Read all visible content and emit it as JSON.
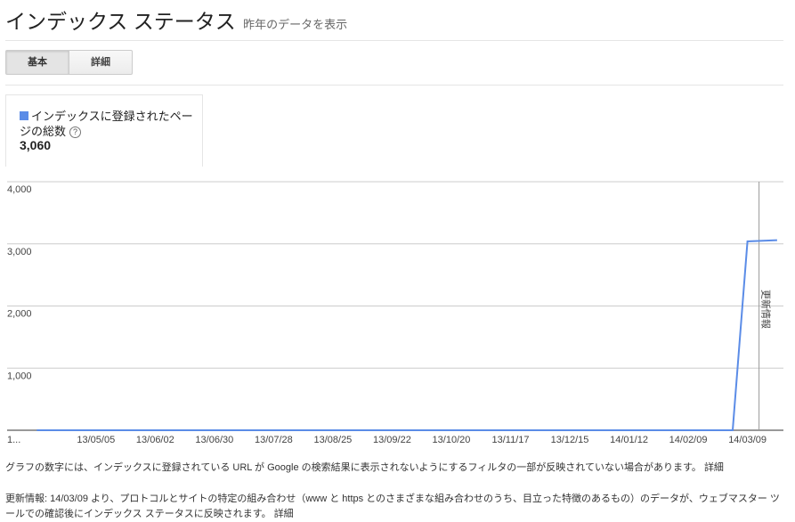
{
  "header": {
    "title": "インデックス ステータス",
    "subtitle": "昨年のデータを表示"
  },
  "tabs": [
    {
      "label": "基本",
      "active": true
    },
    {
      "label": "詳細",
      "active": false
    }
  ],
  "metric": {
    "label": "インデックスに登録されたページの総数",
    "value": "3,060",
    "color": "#5b8ce7",
    "help_icon": "question-circle-icon"
  },
  "chart_data": {
    "type": "line",
    "x": [
      "13/04/07",
      "13/05/05",
      "13/06/02",
      "13/06/30",
      "13/07/28",
      "13/08/25",
      "13/09/22",
      "13/10/20",
      "13/11/17",
      "13/12/15",
      "14/01/12",
      "14/02/09",
      "14/03/02",
      "14/03/09",
      "14/03/23"
    ],
    "series": [
      {
        "name": "インデックスに登録されたページの総数",
        "values": [
          0,
          0,
          0,
          0,
          0,
          0,
          0,
          0,
          0,
          0,
          0,
          0,
          0,
          3040,
          3060
        ]
      }
    ],
    "tick_labels_x": [
      "1...",
      "13/05/05",
      "13/06/02",
      "13/06/30",
      "13/07/28",
      "13/08/25",
      "13/09/22",
      "13/10/20",
      "13/11/17",
      "13/12/15",
      "14/01/12",
      "14/02/09",
      "14/03/09"
    ],
    "tick_labels_y": [
      "1,000",
      "2,000",
      "3,000",
      "4,000"
    ],
    "ylim": [
      0,
      4000
    ],
    "grid": true,
    "annotation": {
      "x": "14/03/09",
      "label": "更新情報"
    }
  },
  "notes": {
    "note1": "グラフの数字には、インデックスに登録されている URL が Google の検索結果に表示されないようにするフィルタの一部が反映されていない場合があります。",
    "note1_link": "詳細",
    "note2": "更新情報: 14/03/09 より、プロトコルとサイトの特定の組み合わせ（www と https とのさまざまな組み合わせのうち、目立った特徴のあるもの）のデータが、ウェブマスター ツールでの確認後にインデックス ステータスに反映されます。",
    "note2_link": "詳細"
  }
}
